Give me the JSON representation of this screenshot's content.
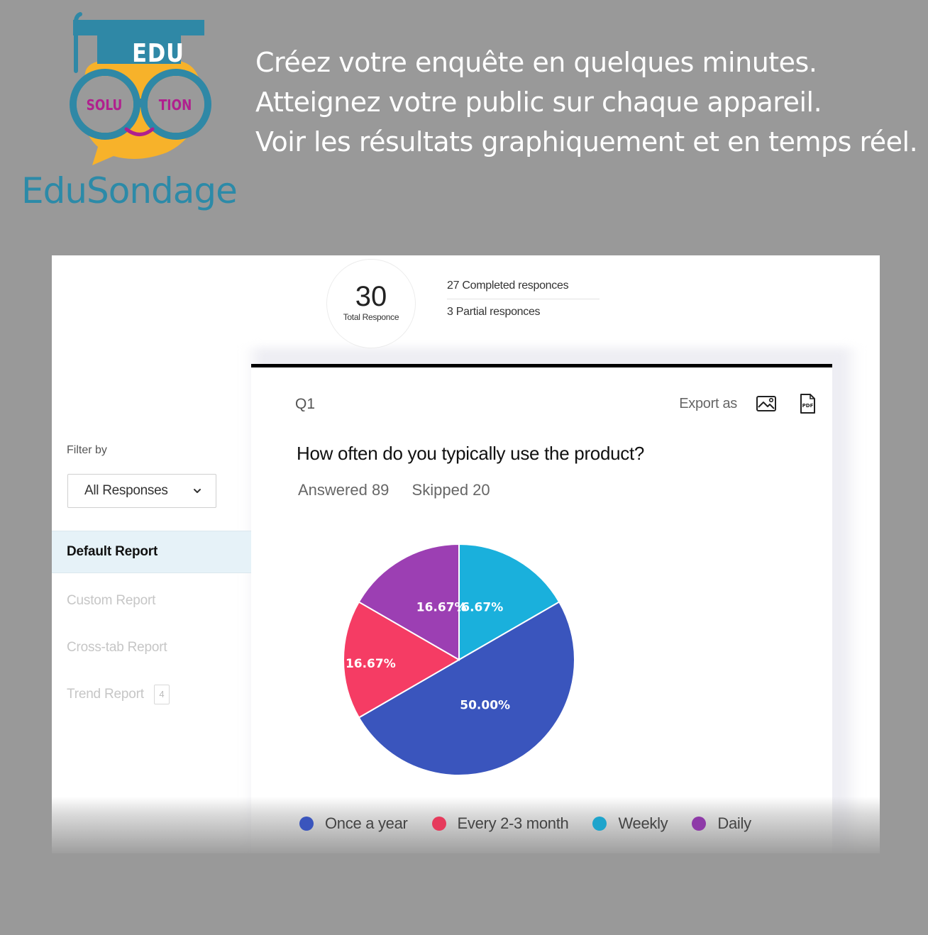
{
  "brand": {
    "cap_text": "EDU",
    "lens_left": "SOLU",
    "lens_right": "TION",
    "wordmark": "EduSondage",
    "colors": {
      "teal": "#2f88a6",
      "yellow": "#f7b22a",
      "magenta": "#b0208e"
    }
  },
  "taglines": [
    "Créez votre enquête en quelques minutes.",
    "Atteignez votre public sur chaque appareil.",
    "Voir les résultats graphiquement et en temps réel."
  ],
  "summary": {
    "total": "30",
    "total_label": "Total Responce",
    "completed": "27 Completed responces",
    "partial": "3 Partial responces"
  },
  "sidebar": {
    "filter_label": "Filter by",
    "filter_value": "All Responses",
    "items": [
      {
        "label": "Default Report",
        "active": true
      },
      {
        "label": "Custom Report",
        "active": false
      },
      {
        "label": "Cross-tab Report",
        "active": false
      },
      {
        "label": "Trend Report",
        "active": false,
        "badge": "4"
      }
    ]
  },
  "question": {
    "number": "Q1",
    "export_label": "Export as",
    "export_icons": [
      "image-icon",
      "pdf-icon"
    ],
    "title": "How often do you typically use the product?",
    "answered": "Answered 89",
    "skipped": "Skipped 20"
  },
  "chart_data": {
    "type": "pie",
    "title": "How often do you typically use the product?",
    "start_angle_deg": 0,
    "direction": "clockwise",
    "slices": [
      {
        "label": "Weekly",
        "value": 16.67,
        "display": "16.67%",
        "color": "#1ab0dc"
      },
      {
        "label": "Once a year",
        "value": 50.0,
        "display": "50.00%",
        "color": "#3a55bd"
      },
      {
        "label": "Every 2-3 month",
        "value": 16.67,
        "display": "16.67%",
        "color": "#f53c64"
      },
      {
        "label": "Daily",
        "value": 16.67,
        "display": "16.67%",
        "color": "#9c3fb3"
      }
    ],
    "legend": [
      {
        "label": "Once a year",
        "color": "#3a55bd"
      },
      {
        "label": "Every 2-3 month",
        "color": "#e63a5c"
      },
      {
        "label": "Weekly",
        "color": "#1ea4cc"
      },
      {
        "label": "Daily",
        "color": "#8e3aa8"
      }
    ],
    "legend_position": "bottom"
  }
}
